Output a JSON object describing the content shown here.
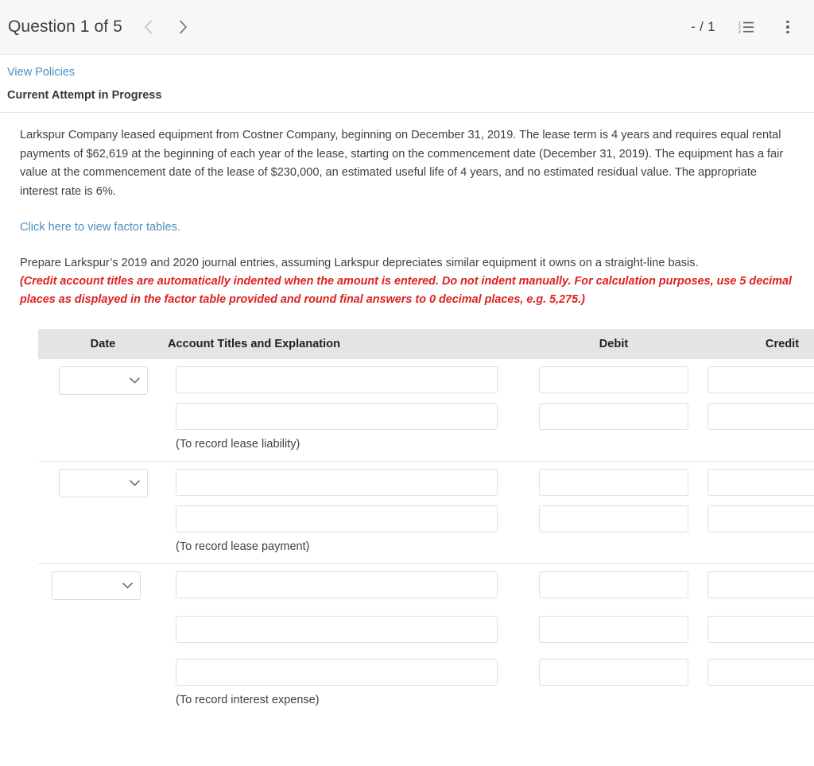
{
  "topbar": {
    "question_label": "Question 1 of 5",
    "prev_icon": "chevron-left-icon",
    "next_icon": "chevron-right-icon",
    "score": "- / 1",
    "list_icon": "numbered-list-icon",
    "menu_icon": "more-vertical-icon"
  },
  "header": {
    "view_policies": "View Policies",
    "attempt_status": "Current Attempt in Progress"
  },
  "question": {
    "problem_text": "Larkspur Company leased equipment from Costner Company, beginning on December 31, 2019. The lease term is 4 years and requires equal rental payments of $62,619 at the beginning of each year of the lease, starting on the commencement date (December 31, 2019). The equipment has a fair value at the commencement date of the lease of $230,000, an estimated useful life of 4 years, and no estimated residual value. The appropriate interest rate is 6%.",
    "factor_tables_link": "Click here to view factor tables.",
    "instruction": "Prepare Larkspur’s 2019 and 2020 journal entries, assuming Larkspur depreciates similar equipment it owns on a straight-line basis.",
    "red_note": "(Credit account titles are automatically indented when the amount is entered. Do not indent manually. For calculation purposes, use 5 decimal places as displayed in the factor table provided and round final answers to 0 decimal places, e.g. 5,275.)"
  },
  "journal_table": {
    "columns": {
      "date": "Date",
      "account": "Account Titles and Explanation",
      "debit": "Debit",
      "credit": "Credit"
    },
    "date_placeholder": "",
    "date_value": "",
    "date_options": [
      ""
    ],
    "account_placeholder": "",
    "amount_placeholder": "",
    "entries": [
      {
        "memo": "(To record lease liability)",
        "lines": [
          {
            "account": "",
            "debit": "",
            "credit": ""
          },
          {
            "account": "",
            "debit": "",
            "credit": ""
          }
        ]
      },
      {
        "memo": "(To record lease payment)",
        "lines": [
          {
            "account": "",
            "debit": "",
            "credit": ""
          },
          {
            "account": "",
            "debit": "",
            "credit": ""
          }
        ]
      },
      {
        "memo": "(To record interest expense)",
        "lines": [
          {
            "account": "",
            "debit": "",
            "credit": ""
          },
          {
            "account": "",
            "debit": "",
            "credit": ""
          },
          {
            "account": "",
            "debit": "",
            "credit": ""
          }
        ]
      }
    ]
  },
  "colors": {
    "link_blue": "#4a8fc0",
    "warning_red": "#e02020",
    "header_gray": "#e4e4e4",
    "topbar_gray": "#f7f7f7"
  }
}
